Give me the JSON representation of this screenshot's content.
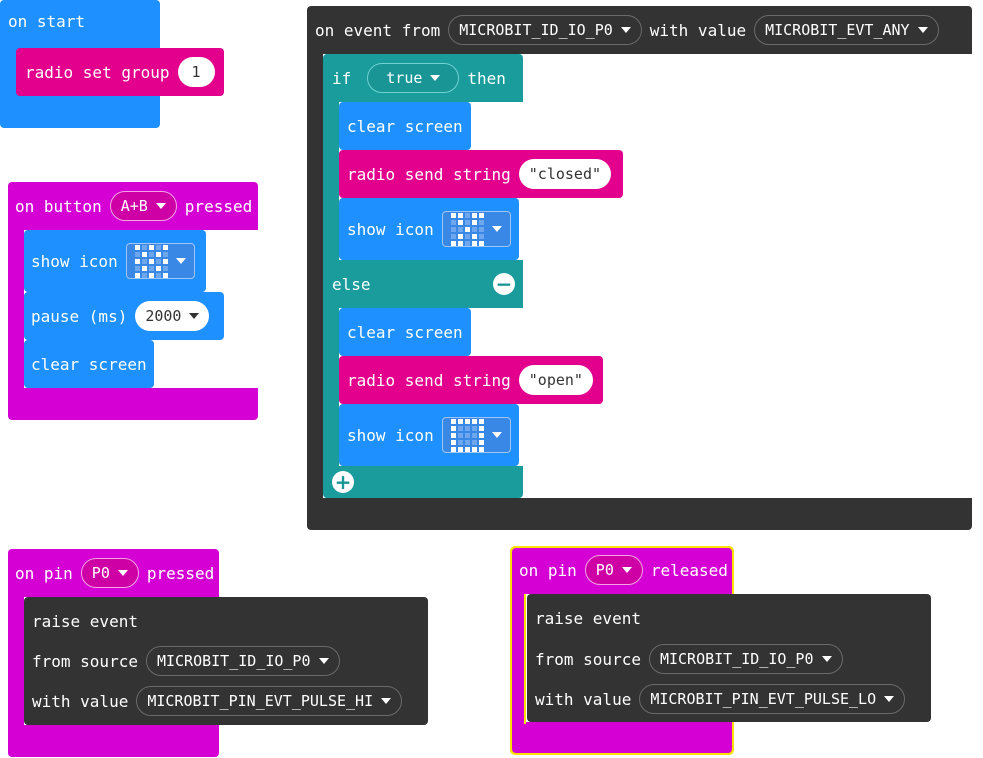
{
  "colors": {
    "basic": "#1e90ff",
    "radio": "#e3008c",
    "input": "#d400d4",
    "control": "#333333",
    "logic": "#1a9c9c",
    "highlight": "#ffe000"
  },
  "on_start": {
    "hat": "on start",
    "radio_set_group": {
      "label": "radio set group",
      "value": "1"
    }
  },
  "on_button": {
    "prefix": "on button",
    "button": "A+B",
    "suffix": "pressed",
    "show_icon": {
      "label": "show icon",
      "icon": "small-diamond-icon"
    },
    "pause": {
      "label": "pause (ms)",
      "value": "2000"
    },
    "clear_screen": "clear screen"
  },
  "on_event": {
    "prefix": "on event from",
    "source": "MICROBIT_ID_IO_P0",
    "mid": "with value",
    "value": "MICROBIT_EVT_ANY",
    "if": {
      "if_label": "if",
      "condition": "true",
      "then_label": "then",
      "then_branch": {
        "clear_screen": "clear screen",
        "radio_send": {
          "label": "radio send string",
          "value": "\"closed\""
        },
        "show_icon": {
          "label": "show icon",
          "icon": "no-icon"
        }
      },
      "else_label": "else",
      "else_branch": {
        "clear_screen": "clear screen",
        "radio_send": {
          "label": "radio send string",
          "value": "\"open\""
        },
        "show_icon": {
          "label": "show icon",
          "icon": "square-icon"
        }
      }
    }
  },
  "on_pin_pressed": {
    "prefix": "on pin",
    "pin": "P0",
    "suffix": "pressed",
    "raise_event": "raise event",
    "from_source_label": "from source",
    "source": "MICROBIT_ID_IO_P0",
    "with_value_label": "with value",
    "value": "MICROBIT_PIN_EVT_PULSE_HI"
  },
  "on_pin_released": {
    "prefix": "on pin",
    "pin": "P0",
    "suffix": "released",
    "raise_event": "raise event",
    "from_source_label": "from source",
    "source": "MICROBIT_ID_IO_P0",
    "with_value_label": "with value",
    "value": "MICROBIT_PIN_EVT_PULSE_LO"
  }
}
